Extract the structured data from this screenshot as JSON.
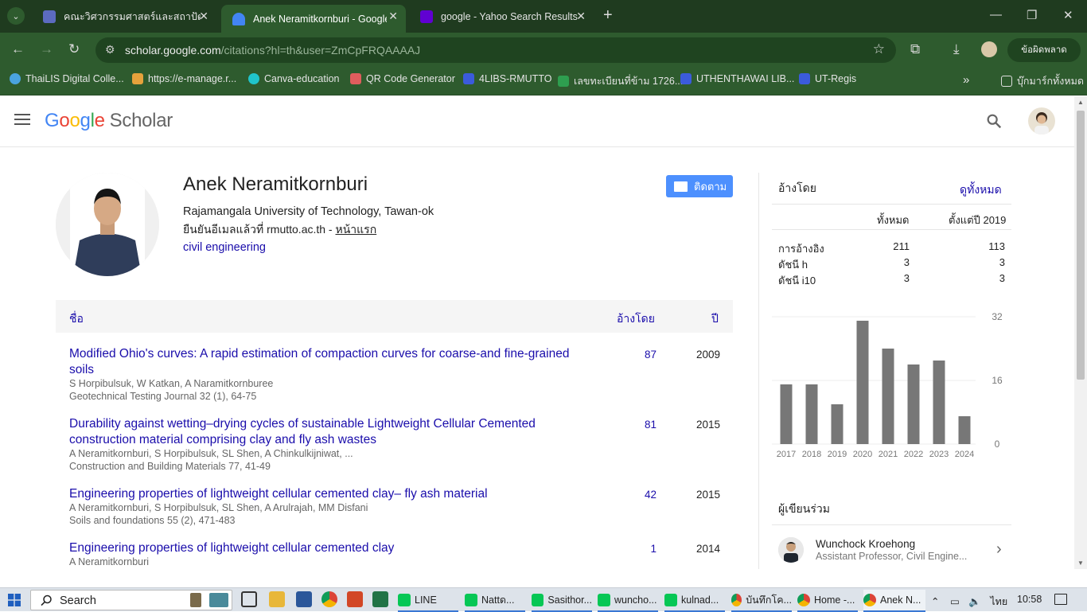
{
  "browser": {
    "tabs": [
      {
        "title": "คณะวิศวกรรมศาสตร์และสถาปัตยกรรม",
        "favicon_color": "#5c6bc0"
      },
      {
        "title": "Anek Neramitkornburi - Google Scholar",
        "favicon_color": "#4285f4"
      },
      {
        "title": "google - Yahoo Search Results",
        "favicon_color": "#6001d2"
      }
    ],
    "url_domain": "scholar.google.com",
    "url_path": "/citations?hl=th&user=ZmCpFRQAAAAJ",
    "error_button": "ข้อผิดพลาด",
    "bookmarks": [
      {
        "label": "ThaiLIS Digital Colle...",
        "color": "#4aa3df"
      },
      {
        "label": "https://e-manage.r...",
        "color": "#e6a23c"
      },
      {
        "label": "Canva-education",
        "color": "#20c4cb"
      },
      {
        "label": "QR Code Generator",
        "color": "#e05d5d"
      },
      {
        "label": "4LIBS-RMUTTO",
        "color": "#3b5bdb"
      },
      {
        "label": "เลขทะเบียนที่ข้าม 1726...",
        "color": "#2e9e4f"
      },
      {
        "label": "UTHENTHAWAI LIB...",
        "color": "#3b5bdb"
      },
      {
        "label": "UT-Regis",
        "color": "#3b5bdb"
      }
    ],
    "bookmarks_all": "บุ๊กมาร์กทั้งหมด"
  },
  "scholar": {
    "logo_google": "Google",
    "logo_scholar": "Scholar",
    "profile": {
      "name": "Anek Neramitkornburi",
      "affiliation": "Rajamangala University of Technology, Tawan-ok",
      "verified_prefix": "ยืนยันอีเมลแล้วที่ rmutto.ac.th - ",
      "homepage": "หน้าแรก",
      "interest": "civil engineering",
      "follow": "ติดตาม"
    },
    "table": {
      "col_title": "ชื่อ",
      "col_cited": "อ้างโดย",
      "col_year": "ปี",
      "rows": [
        {
          "title": "Modified Ohio's curves: A rapid estimation of compaction curves for coarse-and fine-grained soils",
          "authors": "S Horpibulsuk, W Katkan, A Naramitkornburee",
          "venue": "Geotechnical Testing Journal 32 (1), 64-75",
          "cited": "87",
          "year": "2009"
        },
        {
          "title": "Durability against wetting–drying cycles of sustainable Lightweight Cellular Cemented construction material comprising clay and fly ash wastes",
          "authors": "A Neramitkornburi, S Horpibulsuk, SL Shen, A Chinkulkijniwat, ...",
          "venue": "Construction and Building Materials 77, 41-49",
          "cited": "81",
          "year": "2015"
        },
        {
          "title": "Engineering properties of lightweight cellular cemented clay– fly ash material",
          "authors": "A Neramitkornburi, S Horpibulsuk, SL Shen, A Arulrajah, MM Disfani",
          "venue": "Soils and foundations 55 (2), 471-483",
          "cited": "42",
          "year": "2015"
        },
        {
          "title": "Engineering properties of lightweight cellular cemented clay",
          "authors": "A Neramitkornburi",
          "venue": "",
          "cited": "1",
          "year": "2014"
        }
      ]
    },
    "cited_by": {
      "title": "อ้างโดย",
      "view_all": "ดูทั้งหมด",
      "col_all": "ทั้งหมด",
      "col_since": "ตั้งแต่ปี 2019",
      "rows": [
        {
          "label": "การอ้างอิง",
          "all": "211",
          "since": "113"
        },
        {
          "label": "ดัชนี h",
          "all": "3",
          "since": "3"
        },
        {
          "label": "ดัชนี i10",
          "all": "3",
          "since": "3"
        }
      ]
    },
    "coauthors": {
      "title": "ผู้เขียนร่วม",
      "items": [
        {
          "name": "Wunchock Kroehong",
          "role": "Assistant Professor, Civil Engine..."
        }
      ]
    }
  },
  "chart_data": {
    "type": "bar",
    "categories": [
      "2017",
      "2018",
      "2019",
      "2020",
      "2021",
      "2022",
      "2023",
      "2024"
    ],
    "values": [
      15,
      15,
      10,
      31,
      24,
      20,
      21,
      7
    ],
    "ylim": [
      0,
      32
    ],
    "yticks": [
      "32",
      "16",
      "0"
    ],
    "color": "#777777"
  },
  "taskbar": {
    "search": "Search",
    "buttons": [
      {
        "label": "LINE",
        "color": "#06c755"
      },
      {
        "label": "Nattด...",
        "color": "#06c755"
      },
      {
        "label": "Sasithor...",
        "color": "#06c755"
      },
      {
        "label": "wuncho...",
        "color": "#06c755"
      },
      {
        "label": "kulnad...",
        "color": "#06c755"
      },
      {
        "label": "บันทึกโค...",
        "color": "#db4437"
      },
      {
        "label": "Home -...",
        "color": "#db4437"
      },
      {
        "label": "Anek N...",
        "color": "#db4437"
      }
    ],
    "lang": "ไทย",
    "time": "10:58"
  }
}
